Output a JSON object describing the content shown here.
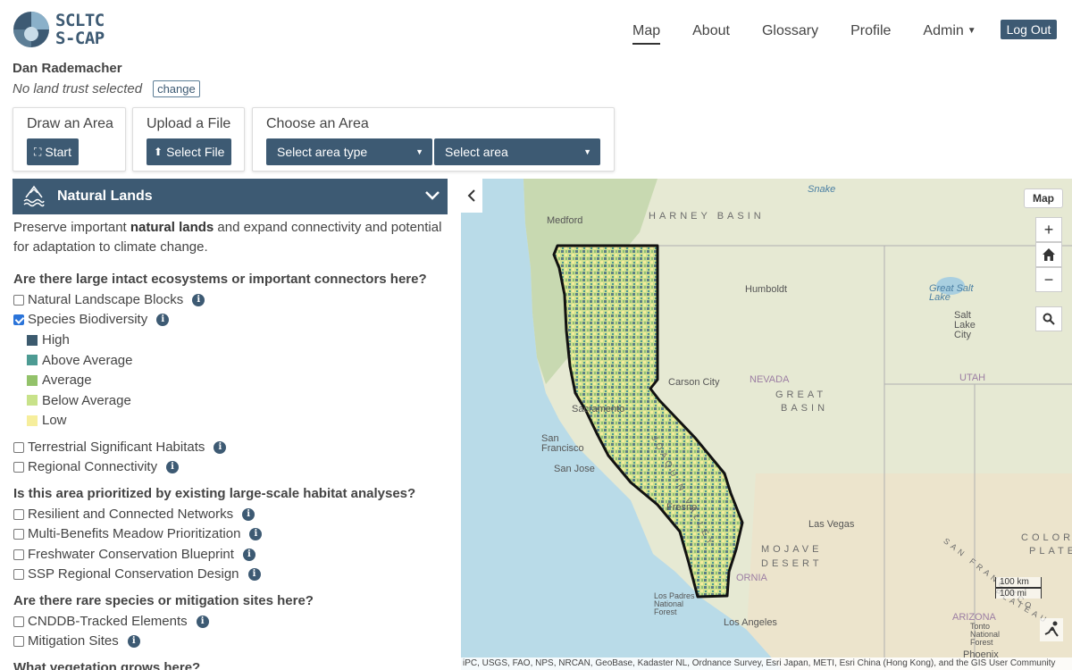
{
  "app": {
    "logo_line1": "SCLTC",
    "logo_line2": "S-CAP"
  },
  "nav": {
    "items": [
      {
        "label": "Map",
        "active": true
      },
      {
        "label": "About"
      },
      {
        "label": "Glossary"
      },
      {
        "label": "Profile"
      },
      {
        "label": "Admin",
        "has_dropdown": true
      }
    ],
    "logout_label": "Log Out"
  },
  "user": {
    "name": "Dan Rademacher",
    "trust_status": "No land trust selected",
    "change_label": "change"
  },
  "tools": {
    "draw": {
      "title": "Draw an Area",
      "button": "Start"
    },
    "upload": {
      "title": "Upload a File",
      "button": "Select File"
    },
    "choose": {
      "title": "Choose an Area",
      "area_type": "Select area type",
      "area": "Select area"
    }
  },
  "section": {
    "title": "Natural Lands",
    "intro_pre": "Preserve important ",
    "intro_bold": "natural lands",
    "intro_post": " and expand connectivity and potential for adaptation to climate change."
  },
  "questions": [
    {
      "text": "Are there large intact ecosystems or important connectors here?",
      "layers": [
        {
          "label": "Natural Landscape Blocks",
          "checked": false
        },
        {
          "label": "Species Biodiversity",
          "checked": true
        },
        {
          "label": "Terrestrial Significant Habitats",
          "checked": false
        },
        {
          "label": "Regional Connectivity",
          "checked": false
        }
      ]
    },
    {
      "text": "Is this area prioritized by existing large-scale habitat analyses?",
      "layers": [
        {
          "label": "Resilient and Connected Networks",
          "checked": false
        },
        {
          "label": "Multi-Benefits Meadow Prioritization",
          "checked": false
        },
        {
          "label": "Freshwater Conservation Blueprint",
          "checked": false
        },
        {
          "label": "SSP Regional Conservation Design",
          "checked": false
        }
      ]
    },
    {
      "text": "Are there rare species or mitigation sites here?",
      "layers": [
        {
          "label": "CNDDB-Tracked Elements",
          "checked": false
        },
        {
          "label": "Mitigation Sites",
          "checked": false
        }
      ]
    },
    {
      "text": "What vegetation grows here?",
      "layers": []
    }
  ],
  "legend": [
    {
      "label": "High",
      "color": "#3c5a6e"
    },
    {
      "label": "Above Average",
      "color": "#4d9b93"
    },
    {
      "label": "Average",
      "color": "#93c26a"
    },
    {
      "label": "Below Average",
      "color": "#c8e28a"
    },
    {
      "label": "Low",
      "color": "#f6ee9c"
    }
  ],
  "map": {
    "basemap_label": "Map",
    "zoom_in": "+",
    "zoom_out": "−",
    "labels": {
      "medford": "Medford",
      "harney": "HARNEY BASIN",
      "humboldt": "Humboldt",
      "great_salt_lake": "Great Salt Lake",
      "salt_lake_city": "Salt Lake City",
      "carson_city": "Carson City",
      "nevada": "NEVADA",
      "great": "GREAT",
      "basin": "BASIN",
      "utah": "UTAH",
      "sacramento": "Sacramento",
      "san_francisco": "San Francisco",
      "san_jose": "San Jose",
      "fresno": "Fresno",
      "joaquin_valley": "JOAQUIN VALLEY",
      "las_vegas": "Las Vegas",
      "mojave": "MOJAVE",
      "desert": "DESERT",
      "colorado": "COLORA",
      "plate": "PLATE",
      "ornia": "ORNIA",
      "los_padres": "Los Padres National Forest",
      "los_angeles": "Los Angeles",
      "arizona": "ARIZONA",
      "tonto": "Tonto National Forest",
      "phoenix": "Phoenix",
      "san_francisco_mtns": "SAN FRANCISCO",
      "plateau": "PLATEAU",
      "snake": "Snake"
    },
    "scale_km": "100 km",
    "scale_mi": "100 mi",
    "attribution": "iPC, USGS, FAO, NPS, NRCAN, GeoBase, Kadaster NL, Ordnance Survey, Esri Japan, METI, Esri China (Hong Kong), and the GIS User Community"
  }
}
